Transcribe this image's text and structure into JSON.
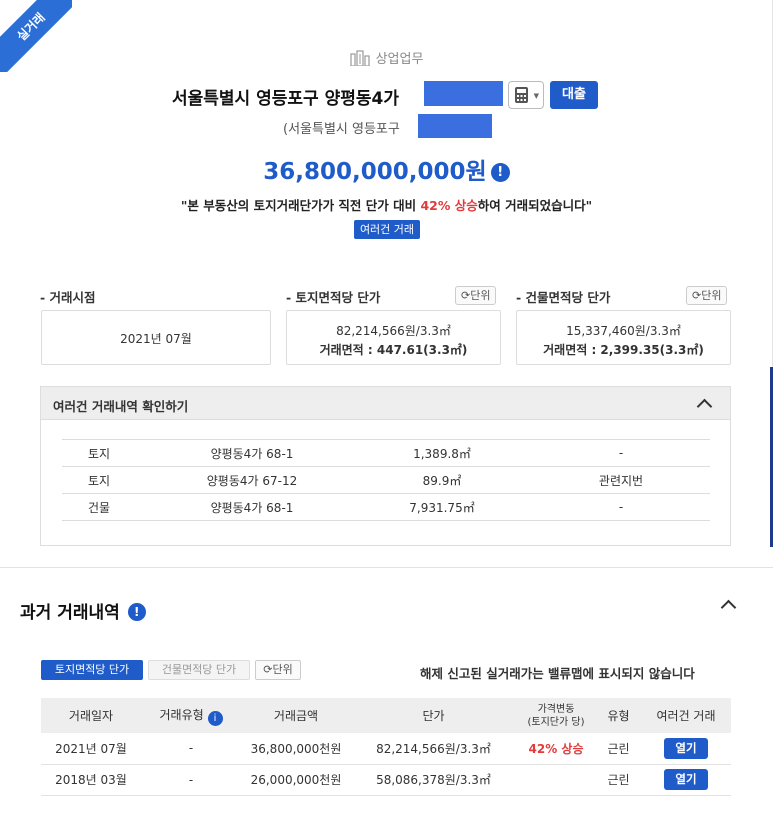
{
  "ribbon": "실거래",
  "usage": "상업업무",
  "address": {
    "main": "서울특별시 영등포구 양평동4가",
    "sub": "(서울특별시 영등포구",
    "loan_label": "대출"
  },
  "price": "36,800,000,000원",
  "quote": {
    "pre": "\"본 부동산의 토지거래단가가 직전 단가 대비 ",
    "highlight": "42% 상승",
    "post": "하여 거래되었습니다\""
  },
  "multi_badge": "여러건 거래",
  "info_cards": [
    {
      "label": "- 거래시점",
      "line1": "2021년 07월",
      "line2": ""
    },
    {
      "label": "- 토지면적당 단가",
      "unit": "단위",
      "line1": "82,214,566원/3.3㎡",
      "line2": "거래면적 : 447.61(3.3㎡)"
    },
    {
      "label": "- 건물면적당 단가",
      "unit": "단위",
      "line1": "15,337,460원/3.3㎡",
      "line2": "거래면적 : 2,399.35(3.3㎡)"
    }
  ],
  "multi_panel": {
    "title": "여러건 거래내역 확인하기",
    "rows": [
      {
        "type": "토지",
        "lot": "양평동4가 68-1",
        "area": "1,389.8㎡",
        "note": "-"
      },
      {
        "type": "토지",
        "lot": "양평동4가 67-12",
        "area": "89.9㎡",
        "note": "관련지번"
      },
      {
        "type": "건물",
        "lot": "양평동4가 68-1",
        "area": "7,931.75㎡",
        "note": "-"
      }
    ]
  },
  "history": {
    "title": "과거 거래내역",
    "tabs": {
      "land": "토지면적당 단가",
      "building": "건물면적당 단가",
      "unit": "단위"
    },
    "notice": "해제 신고된 실거래가는 밸류맵에 표시되지 않습니다",
    "headers": {
      "date": "거래일자",
      "deal_type": "거래유형",
      "amount": "거래금액",
      "unit_price": "단가",
      "change_1": "가격변동",
      "change_2": "(토지단가 당)",
      "kind": "유형",
      "multi": "여러건 거래"
    },
    "rows": [
      {
        "date": "2021년 07월",
        "deal_type": "-",
        "amount": "36,800,000천원",
        "unit_price": "82,214,566원/3.3㎡",
        "change": "42% 상승",
        "kind": "근린",
        "open": "열기"
      },
      {
        "date": "2018년 03월",
        "deal_type": "-",
        "amount": "26,000,000천원",
        "unit_price": "58,086,378원/3.3㎡",
        "change": "",
        "kind": "근린",
        "open": "열기"
      }
    ]
  },
  "colors": {
    "accent": "#1f5bc9",
    "up": "#e23b3b",
    "mask": "#3b6fe0"
  },
  "icons": [
    "building-icon",
    "calculator-icon",
    "info-icon",
    "refresh-icon",
    "chevron-up-icon"
  ]
}
